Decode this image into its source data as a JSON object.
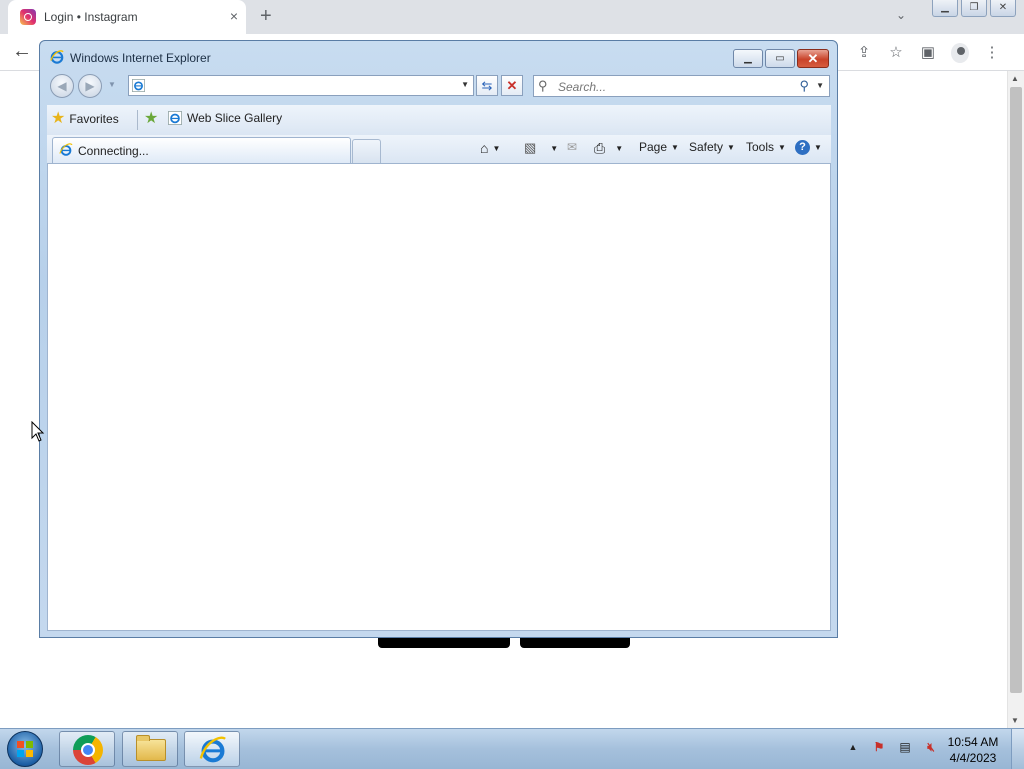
{
  "chrome": {
    "tab_title": "Login • Instagram",
    "tab_close": "×",
    "new_tab": "+",
    "tab_search": "⌄",
    "back": "←",
    "toolbar_icons": [
      "share-icon",
      "star-icon",
      "side-panel-icon",
      "profile-icon",
      "menu-icon"
    ]
  },
  "ie": {
    "window_title": "Windows Internet Explorer",
    "address_value": "",
    "search_placeholder": "Search...",
    "favorites_label": "Favorites",
    "web_slice_label": "Web Slice Gallery",
    "tab_label": "Connecting...",
    "commands": {
      "page": "Page",
      "safety": "Safety",
      "tools": "Tools"
    }
  },
  "taskbar": {
    "apps": [
      "Google Chrome",
      "Windows Explorer",
      "Internet Explorer"
    ],
    "time": "10:54 AM",
    "date": "4/4/2023"
  },
  "colors": {
    "ie_frame": "#b7d0ea",
    "taskbar": "#a5c0dc",
    "close_button": "#c9432a"
  }
}
